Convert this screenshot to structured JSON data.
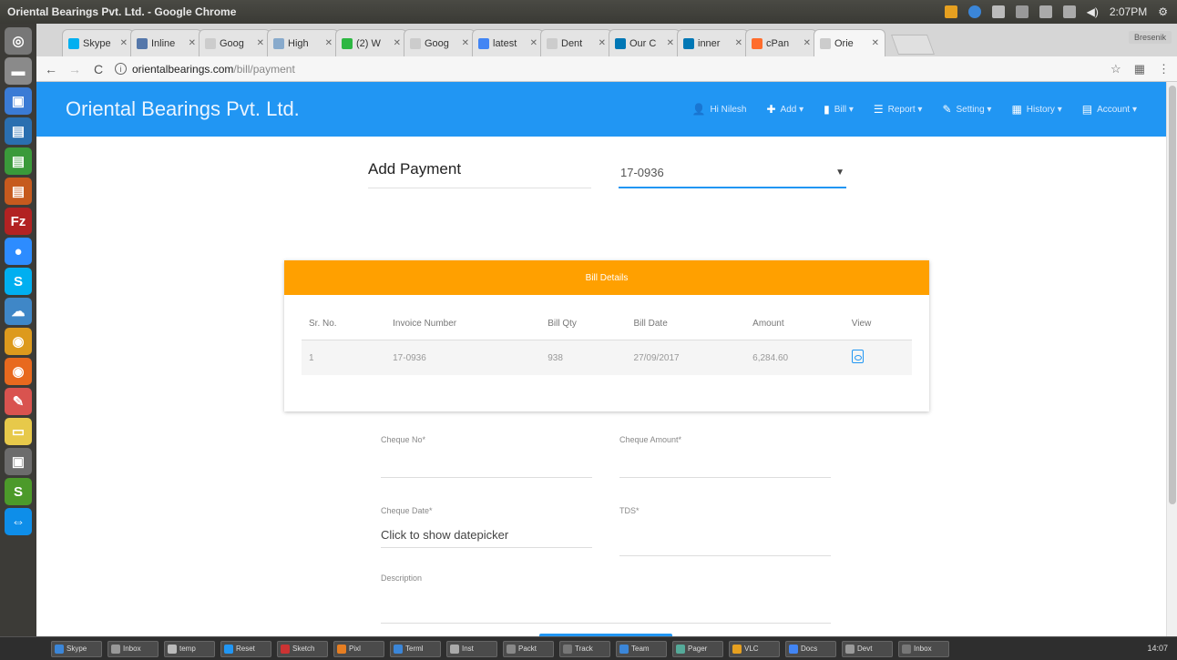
{
  "window": {
    "title": "Oriental Bearings Pvt. Ltd. - Google Chrome",
    "clock": "2:07PM"
  },
  "tabs": [
    {
      "label": "Skype",
      "color": "#00aff0",
      "active": false
    },
    {
      "label": "Inline",
      "color": "#5577aa",
      "active": false
    },
    {
      "label": "Goog",
      "color": "#cccccc",
      "active": false
    },
    {
      "label": "High",
      "color": "#88aacc",
      "active": false
    },
    {
      "label": "(2) W",
      "color": "#2db742",
      "active": false
    },
    {
      "label": "Goog",
      "color": "#cccccc",
      "active": false
    },
    {
      "label": "latest",
      "color": "#4285f4",
      "active": false
    },
    {
      "label": "Dent",
      "color": "#cccccc",
      "active": false
    },
    {
      "label": "Our C",
      "color": "#0077b5",
      "active": false
    },
    {
      "label": "inner",
      "color": "#0077b5",
      "active": false
    },
    {
      "label": "cPan",
      "color": "#ff6c2c",
      "active": false
    },
    {
      "label": "Orie",
      "color": "#cccccc",
      "active": true
    }
  ],
  "profile_label": "Bresenik",
  "address": {
    "host": "orientalbearings.com",
    "path": "/bill/payment"
  },
  "app": {
    "brand": "Oriental Bearings Pvt. Ltd.",
    "nav": [
      {
        "icon": "user-icon",
        "glyph": "👤",
        "label": "Hi Nilesh"
      },
      {
        "icon": "plus-icon",
        "glyph": "✚",
        "label": "Add ▾"
      },
      {
        "icon": "file-icon",
        "glyph": "▮",
        "label": "Bill ▾"
      },
      {
        "icon": "list-icon",
        "glyph": "☰",
        "label": "Report ▾"
      },
      {
        "icon": "wrench-icon",
        "glyph": "✎",
        "label": "Setting ▾"
      },
      {
        "icon": "history-icon",
        "glyph": "▦",
        "label": "History ▾"
      },
      {
        "icon": "account-icon",
        "glyph": "▤",
        "label": "Account ▾"
      }
    ]
  },
  "form": {
    "title": "Add Payment",
    "selected_bill": "17-0936",
    "card_title": "Bill Details",
    "table": {
      "headers": [
        "Sr. No.",
        "Invoice Number",
        "Bill Qty",
        "Bill Date",
        "Amount",
        "View"
      ],
      "rows": [
        {
          "sr": "1",
          "invoice": "17-0936",
          "qty": "938",
          "date": "27/09/2017",
          "amount": "6,284.60"
        }
      ]
    },
    "fields": {
      "cheque_no_label": "Cheque No*",
      "cheque_amount_label": "Cheque Amount*",
      "cheque_date_label": "Cheque Date*",
      "cheque_date_placeholder": "Click to show datepicker",
      "tds_label": "TDS*",
      "description_label": "Description"
    }
  },
  "launcher": [
    {
      "icon": "dash-icon",
      "color": "#777777",
      "glyph": "◎"
    },
    {
      "icon": "files-icon",
      "color": "#8a8a8a",
      "glyph": "▬"
    },
    {
      "icon": "box-icon",
      "color": "#3a7bd5",
      "glyph": "▣"
    },
    {
      "icon": "writer-icon",
      "color": "#2a6fb0",
      "glyph": "▤"
    },
    {
      "icon": "calc-icon",
      "color": "#3a9a3a",
      "glyph": "▤"
    },
    {
      "icon": "impress-icon",
      "color": "#c65a1e",
      "glyph": "▤"
    },
    {
      "icon": "filezilla-icon",
      "color": "#b22222",
      "glyph": "Fz"
    },
    {
      "icon": "zoom-icon",
      "color": "#2d8cff",
      "glyph": "●"
    },
    {
      "icon": "skype-icon",
      "color": "#00aff0",
      "glyph": "S"
    },
    {
      "icon": "cloud-icon",
      "color": "#3f87c7",
      "glyph": "☁"
    },
    {
      "icon": "chrome-icon",
      "color": "#dd9a1d",
      "glyph": "◉"
    },
    {
      "icon": "firefox-icon",
      "color": "#e8691e",
      "glyph": "◉"
    },
    {
      "icon": "tool-icon",
      "color": "#d9534f",
      "glyph": "✎"
    },
    {
      "icon": "notes-icon",
      "color": "#e7c94a",
      "glyph": "▭"
    },
    {
      "icon": "photo-icon",
      "color": "#6c6c6c",
      "glyph": "▣"
    },
    {
      "icon": "app-icon",
      "color": "#4c9a2a",
      "glyph": "S"
    },
    {
      "icon": "teamviewer-icon",
      "color": "#0e8ee9",
      "glyph": "⇔"
    }
  ],
  "taskbar": {
    "items": [
      "Skype",
      "Inbox",
      "temp",
      "Reset",
      "Sketch",
      "Pixl",
      "Terml",
      "Inst",
      "Packt",
      "Track",
      "Team",
      "Pager",
      "VLC",
      "Docs",
      "Devt",
      "Inbox"
    ],
    "clock": "14:07"
  }
}
